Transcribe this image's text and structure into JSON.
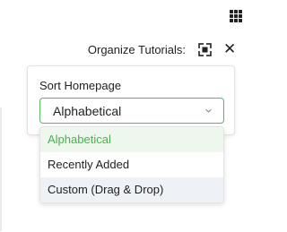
{
  "toolbar": {
    "organize_label": "Organize Tutorials:",
    "icons": {
      "apps": "apps-grid-icon",
      "expand": "expand-icon",
      "close": "close-icon"
    },
    "close_glyph": "✕"
  },
  "sort": {
    "label": "Sort Homepage",
    "selected_value": "Alphabetical",
    "accent_color": "#5cb85c",
    "options": [
      {
        "label": "Alphabetical",
        "state": "selected"
      },
      {
        "label": "Recently Added",
        "state": "default"
      },
      {
        "label": "Custom (Drag & Drop)",
        "state": "hover"
      }
    ]
  }
}
